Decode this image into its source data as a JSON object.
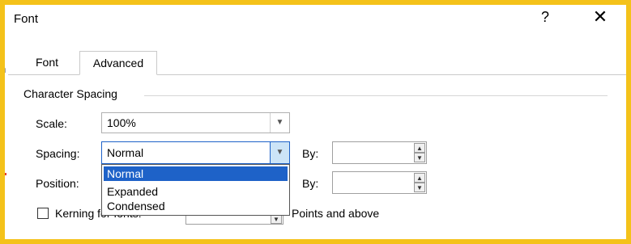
{
  "window": {
    "title": "Font",
    "help_glyph": "?",
    "close_glyph": "✕"
  },
  "background": {
    "left_char": "h"
  },
  "tabs": [
    {
      "label": "Font",
      "selected": false
    },
    {
      "label": "Advanced",
      "selected": true
    }
  ],
  "character_spacing": {
    "section_title": "Character Spacing",
    "scale": {
      "label": "Scale:",
      "value": "100%"
    },
    "spacing": {
      "label": "Spacing:",
      "value": "Normal",
      "by_label": "By:",
      "by_value": "",
      "options": [
        "Normal",
        "Expanded",
        "Condensed"
      ],
      "highlighted_option": "Normal"
    },
    "position": {
      "label": "Position:",
      "by_label": "By:",
      "by_value": ""
    },
    "kerning": {
      "label": "Kerning for fonts:",
      "checked": false,
      "points_value": "",
      "suffix": "Points and above"
    }
  },
  "colors": {
    "frame": "#f4c21a",
    "highlight": "#1e62c8",
    "red_mark": "#e53b2c"
  },
  "icons": {
    "dropdown_arrow": "chevron-down-icon",
    "spin_up": "triangle-up-icon",
    "spin_down": "triangle-down-icon"
  }
}
